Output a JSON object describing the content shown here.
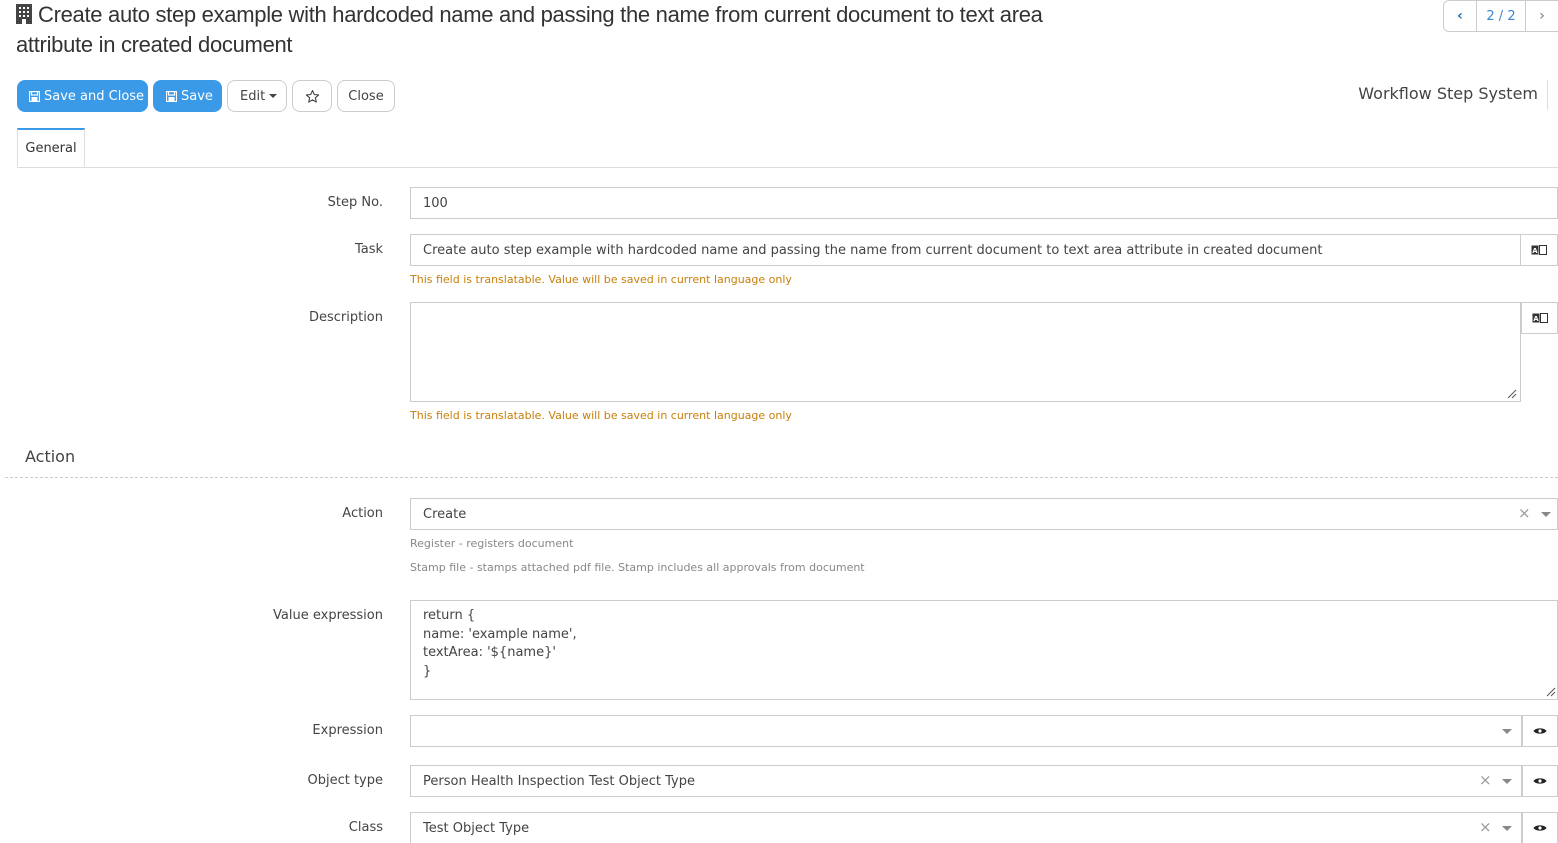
{
  "header": {
    "title": "Create auto step example with hardcoded name and passing the name from current document to text area attribute in created document",
    "pager": {
      "prev_icon": "chevron-left-icon",
      "count": "2 / 2",
      "next_icon": "chevron-right-icon"
    },
    "context_label": "Workflow Step System"
  },
  "toolbar": {
    "save_close_label": "Save and Close",
    "save_label": "Save",
    "edit_label": "Edit",
    "close_label": "Close"
  },
  "tabs": [
    {
      "label": "General",
      "active": true
    }
  ],
  "form": {
    "step_no": {
      "label": "Step No.",
      "value": "100"
    },
    "task": {
      "label": "Task",
      "value": "Create auto step example with hardcoded name and passing the name from current document to text area attribute in created document",
      "help": "This field is translatable. Value will be saved in current language only"
    },
    "description": {
      "label": "Description",
      "value": "",
      "help": "This field is translatable. Value will be saved in current language only"
    },
    "section_action": "Action",
    "action": {
      "label": "Action",
      "value": "Create",
      "help1": "Register - registers document",
      "help2": "Stamp file - stamps attached pdf file. Stamp includes all approvals from document"
    },
    "value_expression": {
      "label": "Value expression",
      "value": "return {\nname: 'example name',\ntextArea: '${name}'\n}"
    },
    "expression": {
      "label": "Expression",
      "value": ""
    },
    "object_type": {
      "label": "Object type",
      "value": "Person Health Inspection Test Object Type"
    },
    "class": {
      "label": "Class",
      "value": "Test Object Type"
    }
  },
  "colors": {
    "primary": "#3a9ae8",
    "help_text": "#c87f0a",
    "border": "#cccccc"
  }
}
